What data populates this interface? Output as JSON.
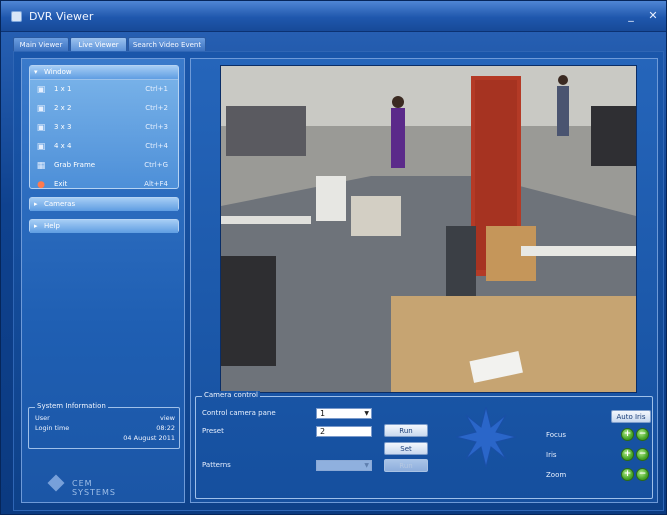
{
  "window": {
    "title": "DVR Viewer",
    "minimize": "_",
    "close": "✕"
  },
  "tabs": [
    {
      "label": "Main Viewer"
    },
    {
      "label": "Live Viewer"
    },
    {
      "label": "Search Video Event"
    }
  ],
  "sidebar": {
    "window_group": {
      "header": "Window",
      "items": [
        {
          "icon": "layout-1x1-icon",
          "label": "1 x 1",
          "shortcut": "Ctrl+1"
        },
        {
          "icon": "layout-2x2-icon",
          "label": "2 x 2",
          "shortcut": "Ctrl+2"
        },
        {
          "icon": "layout-3x3-icon",
          "label": "3 x 3",
          "shortcut": "Ctrl+3"
        },
        {
          "icon": "layout-4x4-icon",
          "label": "4 x 4",
          "shortcut": "Ctrl+4"
        },
        {
          "icon": "grab-frame-icon",
          "label": "Grab Frame",
          "shortcut": "Ctrl+G"
        },
        {
          "icon": "exit-icon",
          "label": "Exit",
          "shortcut": "Alt+F4"
        }
      ]
    },
    "cameras_header": "Cameras",
    "help_header": "Help",
    "system_info": {
      "title": "System Information",
      "user_label": "User",
      "user_value": "view",
      "login_time_label": "Login time",
      "login_time_value": "08:22",
      "date_value": "04 August 2011"
    },
    "logo_text": "CEM SYSTEMS"
  },
  "camera_control": {
    "title": "Camera control",
    "control_label": "Control camera pane",
    "control_value": "1",
    "preset_label": "Preset",
    "preset_value": "2",
    "run_label": "Run",
    "set_label": "Set",
    "pattern_label": "Patterns",
    "pattern_value": "",
    "pattern_run_label": "Run",
    "auto_iris_label": "Auto Iris",
    "focus_label": "Focus",
    "iris_label": "Iris",
    "zoom_label": "Zoom",
    "plus": "+",
    "minus": "−"
  },
  "colors": {
    "accent": "#1f5fb3",
    "ptz_star": "#2a66c9",
    "green": "#4aa82a"
  }
}
